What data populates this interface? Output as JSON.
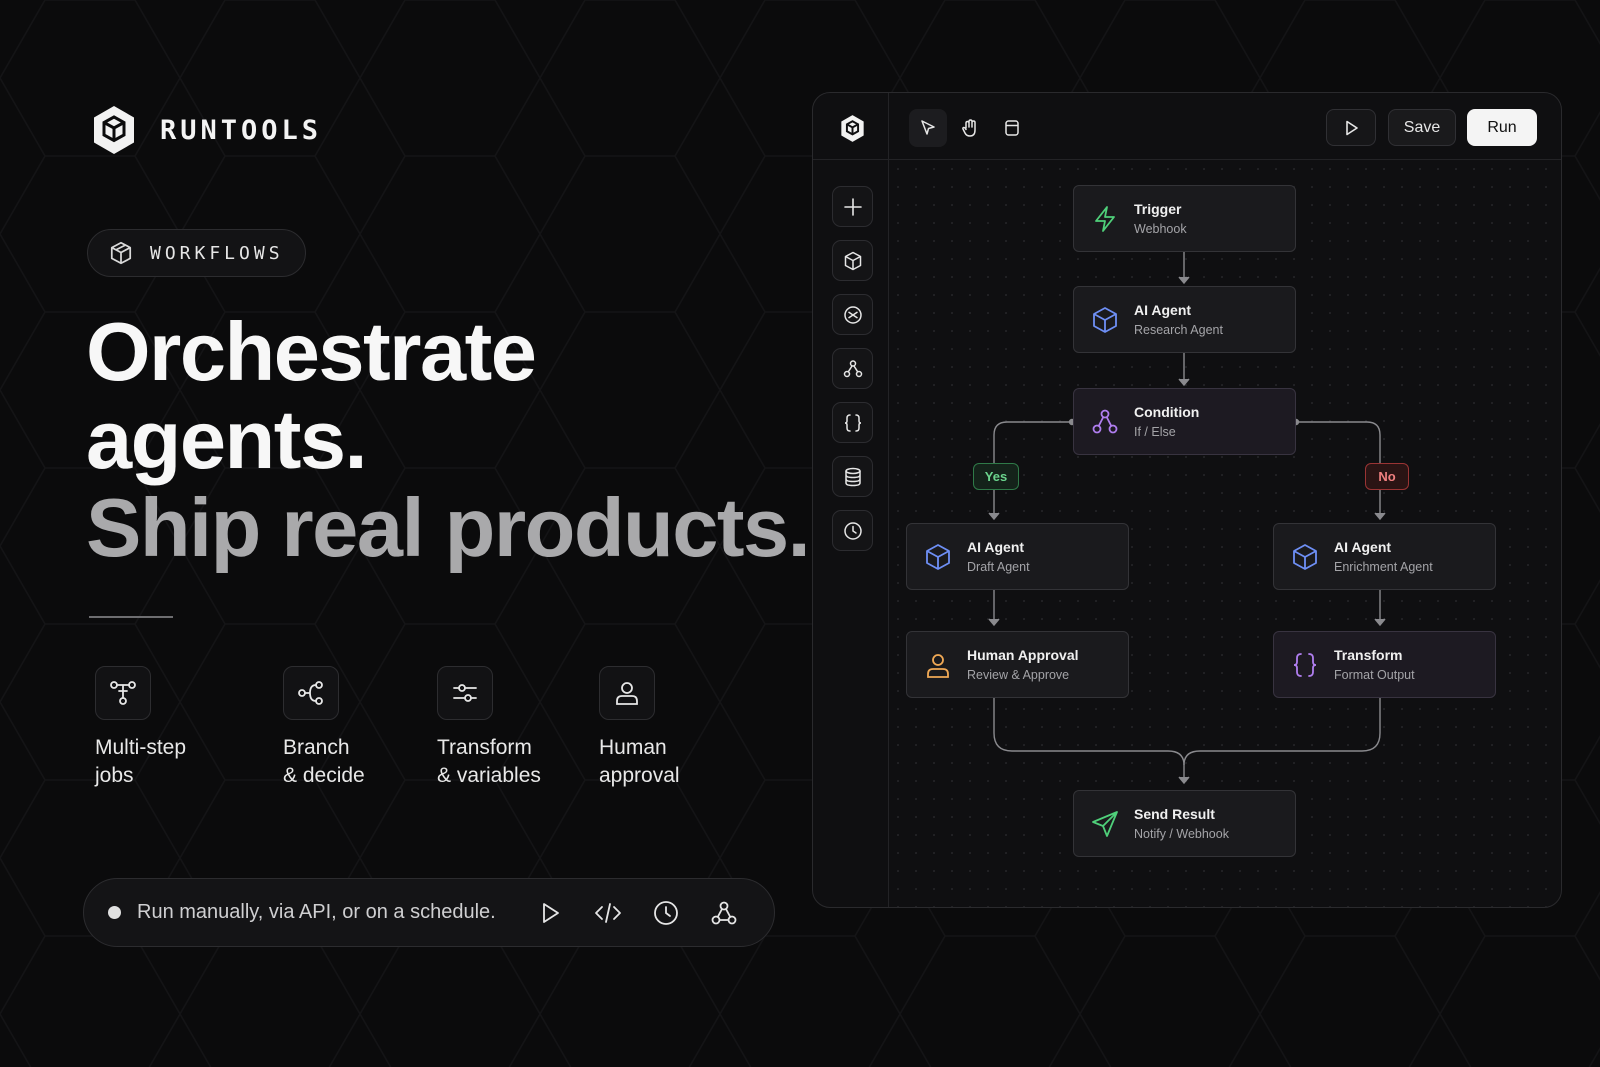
{
  "brand": {
    "name": "RUNTOOLS",
    "logo_icon": "cube-hexagon-icon"
  },
  "badge": {
    "label": "WORKFLOWS",
    "icon": "cube-icon"
  },
  "headline": {
    "line1": "Orchestrate",
    "line2": "agents.",
    "line3": "Ship real products."
  },
  "features": [
    {
      "icon": "multi-step-icon",
      "label": "Multi-step\njobs"
    },
    {
      "icon": "branch-icon",
      "label": "Branch\n& decide"
    },
    {
      "icon": "sliders-icon",
      "label": "Transform\n& variables"
    },
    {
      "icon": "user-icon",
      "label": "Human\napproval"
    }
  ],
  "run_bar": {
    "text": "Run manually, via API, or on a schedule.",
    "icons": [
      "play-icon",
      "code-icon",
      "clock-icon",
      "webhook-icon"
    ]
  },
  "toolbar": {
    "tools": [
      "cursor-icon",
      "hand-icon",
      "frame-icon"
    ],
    "play_icon": "play-icon",
    "save_label": "Save",
    "run_label": "Run"
  },
  "sidebar": {
    "buttons": [
      "plus-icon",
      "cube-icon",
      "agent-icon",
      "condition-icon",
      "braces-icon",
      "database-icon",
      "clock-icon"
    ]
  },
  "workflow": {
    "nodes": {
      "trigger": {
        "title": "Trigger",
        "subtitle": "Webhook"
      },
      "research": {
        "title": "AI Agent",
        "subtitle": "Research Agent"
      },
      "condition": {
        "title": "Condition",
        "subtitle": "If / Else"
      },
      "draft": {
        "title": "AI Agent",
        "subtitle": "Draft Agent"
      },
      "enrich": {
        "title": "AI Agent",
        "subtitle": "Enrichment Agent"
      },
      "approval": {
        "title": "Human Approval",
        "subtitle": "Review & Approve"
      },
      "transform": {
        "title": "Transform",
        "subtitle": "Format Output"
      },
      "send": {
        "title": "Send Result",
        "subtitle": "Notify / Webhook"
      }
    },
    "branch_yes": "Yes",
    "branch_no": "No"
  },
  "colors": {
    "accent_green": "#4fd07a",
    "accent_blue": "#6e8ff5",
    "accent_purple": "#b07ef0",
    "accent_orange": "#f0a955",
    "yes_green": "#6bd58d",
    "no_red": "#f08080"
  }
}
